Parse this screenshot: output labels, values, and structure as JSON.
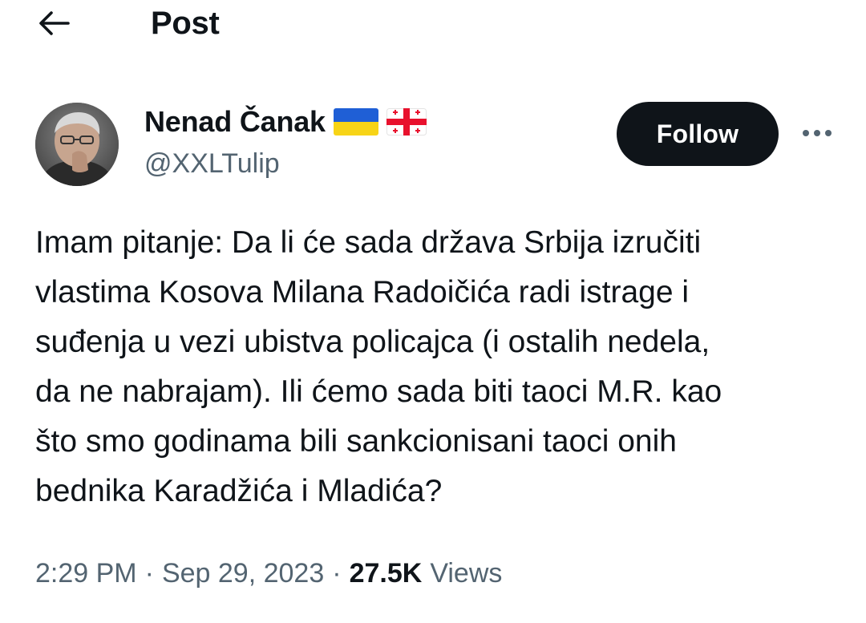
{
  "header": {
    "title": "Post",
    "back_icon": "arrow-left-icon"
  },
  "author": {
    "name": "Nenad Čanak",
    "handle": "@XXLTulip",
    "flags": [
      "ukraine-flag-icon",
      "georgia-flag-icon"
    ]
  },
  "follow_button": {
    "label": "Follow"
  },
  "more_icon": "more-horizontal-icon",
  "tweet": {
    "lines": [
      "Imam pitanje: Da li će sada država Srbija izručiti",
      "vlastima Kosova Milana Radoičića radi istrage i",
      "suđenja u vezi ubistva policajca (i ostalih nedela,",
      "da ne nabrajam). Ili ćemo sada biti taoci M.R. kao",
      "što smo godinama bili sankcionisani taoci onih",
      "bednika Karadžića i Mladića?"
    ]
  },
  "meta": {
    "time": "2:29 PM",
    "separator": "·",
    "date": "Sep 29, 2023",
    "views_count": "27.5K",
    "views_label": "Views"
  },
  "colors": {
    "text_primary": "#0f1419",
    "text_secondary": "#536471",
    "follow_bg": "#0f1419",
    "follow_text": "#ffffff",
    "ukraine_blue": "#1f5fd6",
    "ukraine_yellow": "#f7d417",
    "georgia_red": "#e8112d"
  }
}
